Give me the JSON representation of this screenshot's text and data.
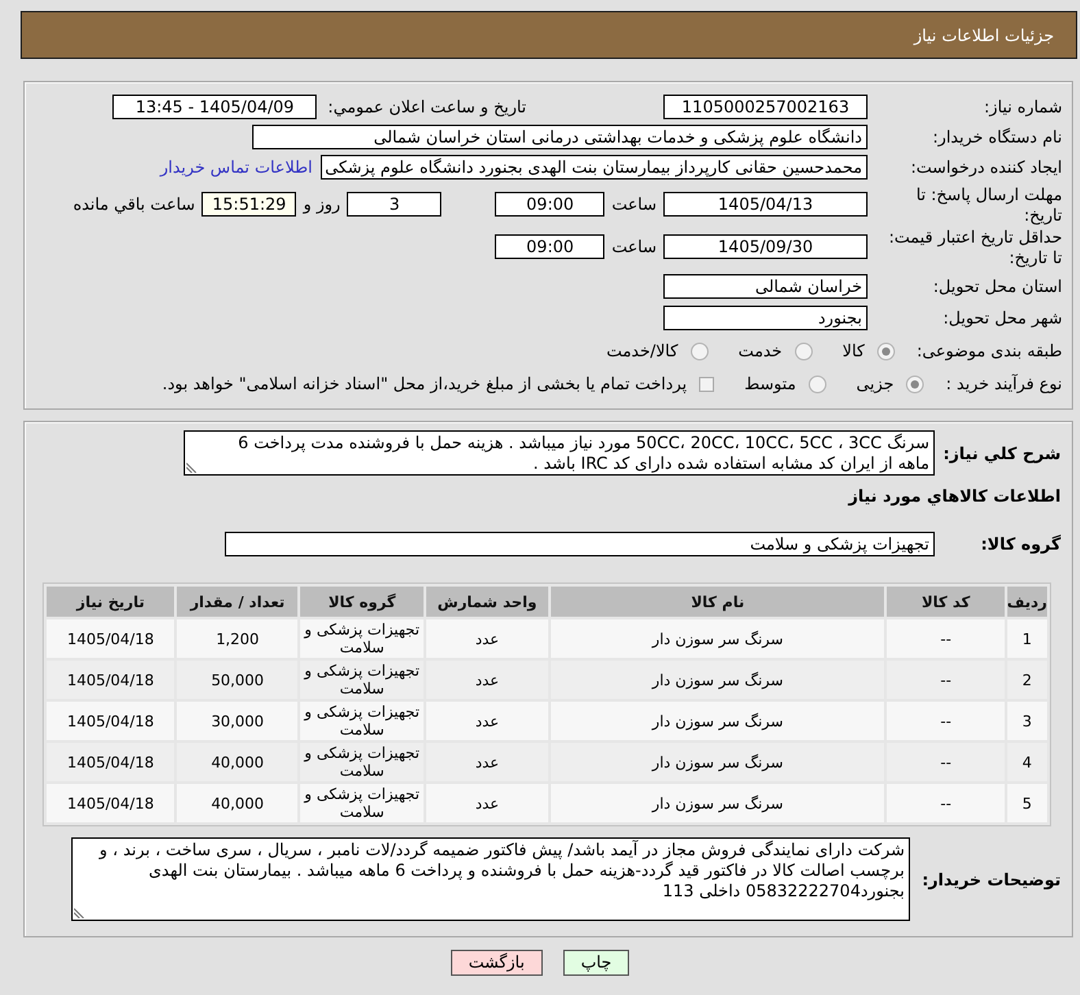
{
  "header": {
    "title": "جزئیات اطلاعات نیاز"
  },
  "details": {
    "need_number": {
      "label": "شماره نیاز:",
      "value": "1105000257002163"
    },
    "announce": {
      "label": "تاریخ و ساعت اعلان عمومي:",
      "value": "1405/04/09 - 13:45"
    },
    "buyer_org": {
      "label": "نام دستگاه خریدار:",
      "value": "دانشگاه علوم پزشکی و خدمات بهداشتی درمانی استان خراسان شمالی"
    },
    "requester": {
      "label": "ایجاد کننده درخواست:",
      "value": "محمدحسین حقانی کارپرداز بیمارستان بنت الهدی بجنورد دانشگاه علوم پزشکی",
      "link": "اطلاعات تماس خریدار"
    },
    "response_deadline": {
      "label": "مهلت ارسال پاسخ: تا تاریخ:",
      "date": "1405/04/13",
      "time_label": "ساعت",
      "time": "09:00",
      "days": "3",
      "days_label": "روز و",
      "remaining": "15:51:29",
      "remaining_label": "ساعت باقي مانده"
    },
    "price_validity": {
      "label": "حداقل تاریخ اعتبار قیمت: تا تاریخ:",
      "date": "1405/09/30",
      "time_label": "ساعت",
      "time": "09:00"
    },
    "province": {
      "label": "استان محل تحویل:",
      "value": "خراسان شمالی"
    },
    "city": {
      "label": "شهر محل تحویل:",
      "value": "بجنورد"
    },
    "category": {
      "label": "طبقه بندی موضوعی:",
      "options": [
        {
          "label": "کالا",
          "selected": true
        },
        {
          "label": "خدمت",
          "selected": false
        },
        {
          "label": "کالا/خدمت",
          "selected": false
        }
      ]
    },
    "process": {
      "label": "نوع فرآیند خرید :",
      "options": [
        {
          "label": "جزیی",
          "selected": true
        },
        {
          "label": "متوسط",
          "selected": false
        }
      ],
      "treasury_checkbox": {
        "label": "پرداخت تمام یا بخشی از مبلغ خرید،از محل \"اسناد خزانه اسلامی\" خواهد بود.",
        "checked": false
      }
    }
  },
  "summary": {
    "label": "شرح کلي نیاز:",
    "text": "سرنگ 50CC، 20CC، 10CC، 5CC ، 3CC مورد نیاز میباشد . هزینه حمل با فروشنده مدت پرداخت 6 ماهه از ایران کد مشابه استفاده شده دارای کد IRC باشد ."
  },
  "goods": {
    "heading": "اطلاعات کالاهاي مورد نیاز",
    "group_label": "گروه کالا:",
    "group_value": "تجهیزات پزشکی و سلامت",
    "table": {
      "columns": [
        "ردیف",
        "کد کالا",
        "نام کالا",
        "واحد شمارش",
        "گروه کالا",
        "تعداد / مقدار",
        "تاریخ نیاز"
      ],
      "rows": [
        [
          "1",
          "--",
          "سرنگ سر سوزن دار",
          "عدد",
          "تجهیزات پزشکی و سلامت",
          "1,200",
          "1405/04/18"
        ],
        [
          "2",
          "--",
          "سرنگ سر سوزن دار",
          "عدد",
          "تجهیزات پزشکی و سلامت",
          "50,000",
          "1405/04/18"
        ],
        [
          "3",
          "--",
          "سرنگ سر سوزن دار",
          "عدد",
          "تجهیزات پزشکی و سلامت",
          "30,000",
          "1405/04/18"
        ],
        [
          "4",
          "--",
          "سرنگ سر سوزن دار",
          "عدد",
          "تجهیزات پزشکی و سلامت",
          "40,000",
          "1405/04/18"
        ],
        [
          "5",
          "--",
          "سرنگ سر سوزن دار",
          "عدد",
          "تجهیزات پزشکی و سلامت",
          "40,000",
          "1405/04/18"
        ]
      ]
    }
  },
  "buyer_notes": {
    "label": "توضیحات خریدار:",
    "text": "شرکت دارای نمایندگی فروش مجاز در آیمد باشد/ پیش فاکتور ضمیمه گردد/لات نامبر ، سریال ، سری ساخت ، برند ، و برچسب اصالت کالا در فاکتور قید گردد-هزینه حمل با فروشنده و پرداخت 6 ماهه میباشد . بیمارستان بنت الهدی بجنورد05832222704 داخلی 113"
  },
  "buttons": [
    {
      "label": "چاپ",
      "kind": "print"
    },
    {
      "label": "بازگشت",
      "kind": "back"
    }
  ]
}
